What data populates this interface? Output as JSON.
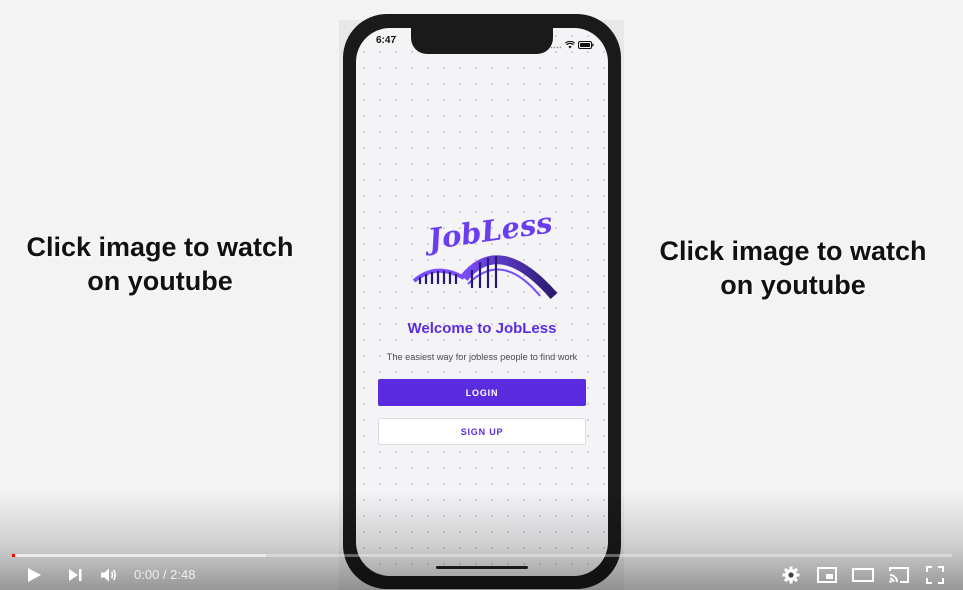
{
  "caption_left": "Click image to watch on youtube",
  "caption_right": "Click image to watch on youtube",
  "phone": {
    "status_time": "6:47",
    "logo_text": "JobLess",
    "welcome_title": "Welcome to JobLess",
    "tagline": "The easiest way for jobless people to find work",
    "login_label": "LOGIN",
    "signup_label": "SIGN UP",
    "colors": {
      "accent": "#5b2be0",
      "screen_bg": "#f4f4f6"
    }
  },
  "player": {
    "current_time": "0:00",
    "time_separator": " / ",
    "duration": "2:48",
    "progress_played": 0.0,
    "progress_loaded": 0.27,
    "icons": [
      "play-icon",
      "next-icon",
      "volume-icon",
      "settings-icon",
      "miniplayer-icon",
      "theater-mode-icon",
      "cast-icon",
      "fullscreen-icon"
    ]
  }
}
